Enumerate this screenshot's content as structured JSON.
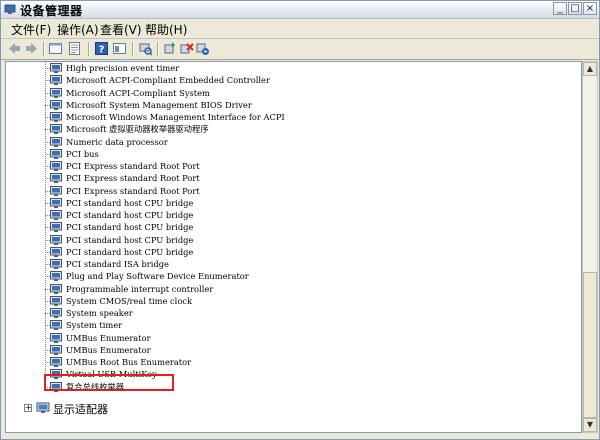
{
  "window": {
    "title": "设备管理器",
    "minimize": "_",
    "maximize": "□",
    "close": "×"
  },
  "menu": {
    "items": [
      "文件(F)",
      "操作(A)",
      "查看(V)",
      "帮助(H)"
    ]
  },
  "toolbar": {
    "icons": [
      "back-icon",
      "forward-icon",
      "computer-view-icon",
      "properties-list-icon",
      "help-icon",
      "console-icon",
      "scan-hardware-icon",
      "update-driver-icon",
      "uninstall-icon",
      "disable-icon"
    ]
  },
  "tree": {
    "devices": [
      "High precision event timer",
      "Microsoft ACPI-Compliant Embedded Controller",
      "Microsoft ACPI-Compliant System",
      "Microsoft System Management BIOS Driver",
      "Microsoft Windows Management Interface for ACPI",
      "Microsoft 虚拟驱动器枚举器驱动程序",
      "Numeric data processor",
      "PCI bus",
      "PCI Express standard Root Port",
      "PCI Express standard Root Port",
      "PCI Express standard Root Port",
      "PCI standard host CPU bridge",
      "PCI standard host CPU bridge",
      "PCI standard host CPU bridge",
      "PCI standard host CPU bridge",
      "PCI standard host CPU bridge",
      "PCI standard ISA bridge",
      "Plug and Play Software Device Enumerator",
      "Programmable interrupt controller",
      "System CMOS/real time clock",
      "System speaker",
      "System timer",
      "UMBus Enumerator",
      "UMBus Enumerator",
      "UMBus Root Bus Enumerator",
      "Virtual USB MultiKey",
      "复合总线枚举器"
    ],
    "selected": "Virtual USB MultiKey",
    "category": {
      "expander": "+",
      "label": "显示适配器"
    }
  },
  "colors": {
    "highlight_box": "#e02020",
    "tree_bg": "#ffffff",
    "chrome": "#ece9d8"
  }
}
